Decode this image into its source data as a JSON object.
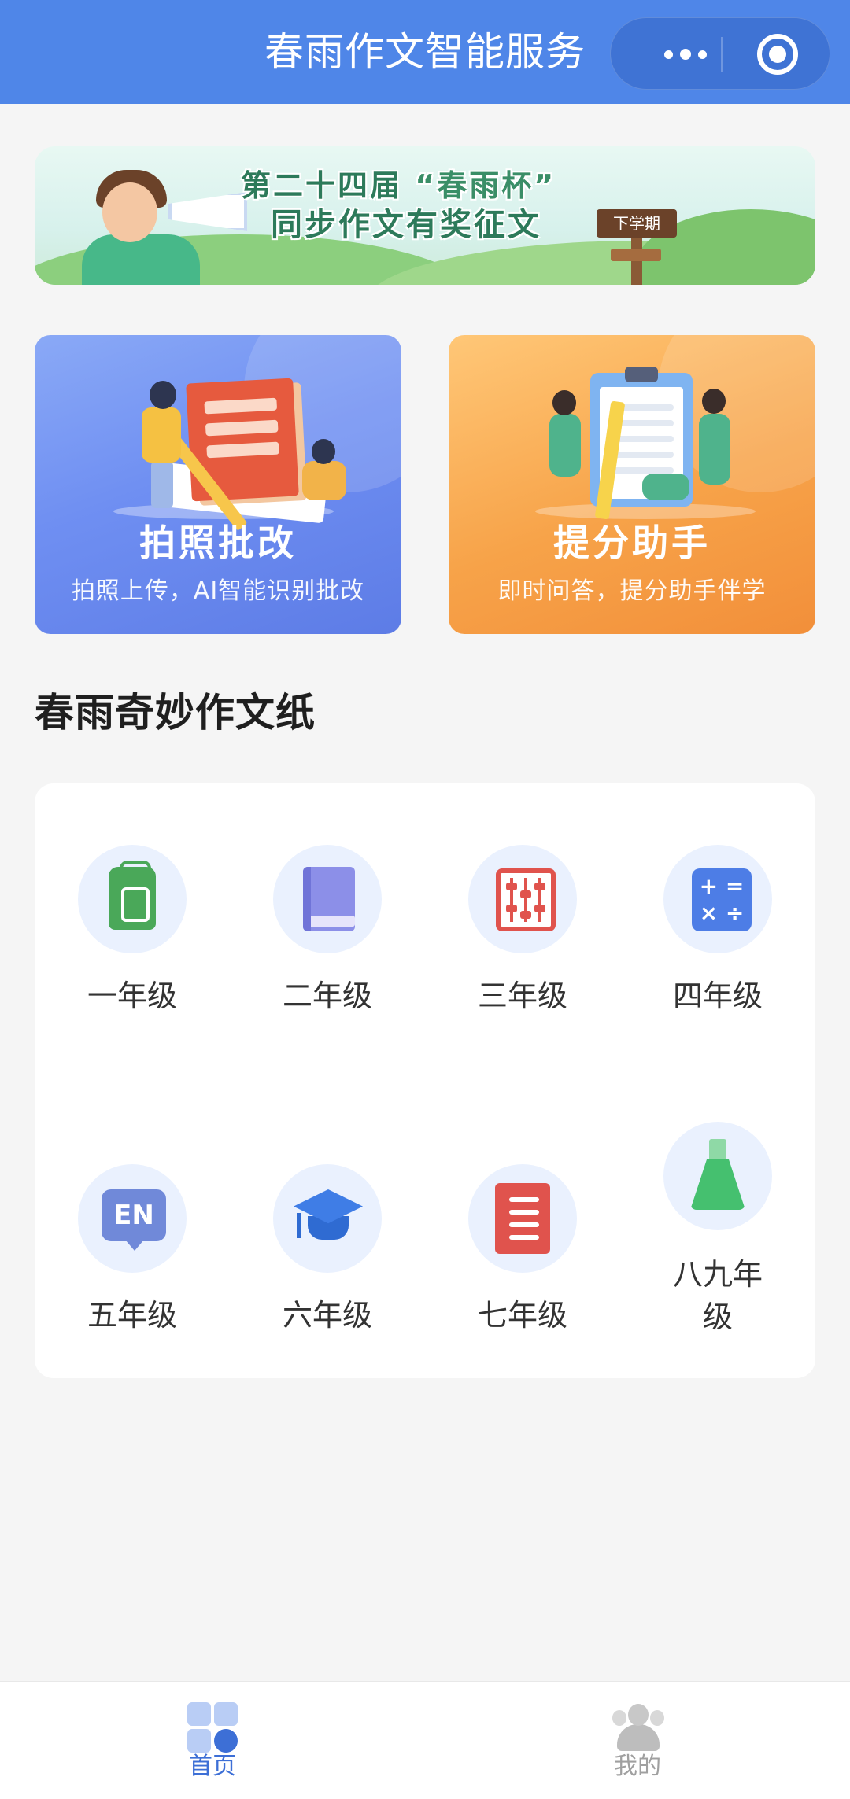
{
  "header": {
    "title": "春雨作文智能服务",
    "more_icon": "more-dots-icon",
    "close_icon": "target-circle-icon"
  },
  "banner": {
    "line1_prefix": "第二十四届",
    "line1_highlight": "“春雨杯”",
    "line2": "同步作文有奖征文",
    "tag": "下学期"
  },
  "features": [
    {
      "title": "拍照批改",
      "subtitle": "拍照上传，AI智能识别批改",
      "icon": "photo-correction-illustration",
      "color": "#6f8ff2"
    },
    {
      "title": "提分助手",
      "subtitle": "即时问答，提分助手伴学",
      "icon": "clipboard-assistant-illustration",
      "color": "#f7a349"
    }
  ],
  "section": {
    "title": "春雨奇妙作文纸"
  },
  "grades": [
    {
      "label": "一年级",
      "icon": "backpack-icon"
    },
    {
      "label": "二年级",
      "icon": "book-icon"
    },
    {
      "label": "三年级",
      "icon": "abacus-icon"
    },
    {
      "label": "四年级",
      "icon": "calculator-icon"
    },
    {
      "label": "五年级",
      "icon": "english-bubble-icon"
    },
    {
      "label": "六年级",
      "icon": "graduation-cap-icon"
    },
    {
      "label": "七年级",
      "icon": "scroll-icon"
    },
    {
      "label_line1": "八九年",
      "label_line2": "级",
      "icon": "flask-icon"
    }
  ],
  "tabbar": {
    "items": [
      {
        "label": "首页",
        "icon": "home-grid-icon",
        "active": true
      },
      {
        "label": "我的",
        "icon": "profile-icon",
        "active": false
      }
    ]
  },
  "colors": {
    "header": "#4f86e8",
    "accent": "#3d6fd6",
    "background": "#f5f5f5"
  }
}
